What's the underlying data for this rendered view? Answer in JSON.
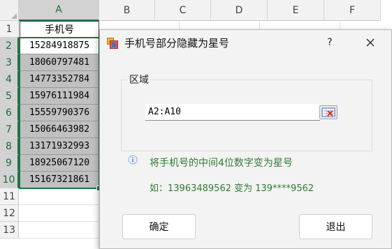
{
  "sheet": {
    "columns": [
      "A",
      "B",
      "C",
      "D",
      "E",
      "F"
    ],
    "rows": [
      "1",
      "2",
      "3",
      "4",
      "5",
      "6",
      "7",
      "8",
      "9",
      "10",
      "11",
      "12",
      "13"
    ],
    "header": "手机号",
    "phones": [
      "15284918875",
      "18060797481",
      "14773352784",
      "15976111984",
      "15559790376",
      "15066463982",
      "13171932993",
      "18925067120",
      "15167321861"
    ]
  },
  "dialog": {
    "title": "手机号部分隐藏为星号",
    "help": "?",
    "group_label": "区域",
    "range_value": "A2:A10",
    "info": "将手机号的中间4位数字变为星号",
    "example": "如：13963489562 变为 139****9562",
    "ok_label": "确定",
    "exit_label": "退出"
  },
  "colors": {
    "accent": "#217346",
    "info_text": "#2e7d32",
    "selected_fill": "#c0c0c0"
  }
}
